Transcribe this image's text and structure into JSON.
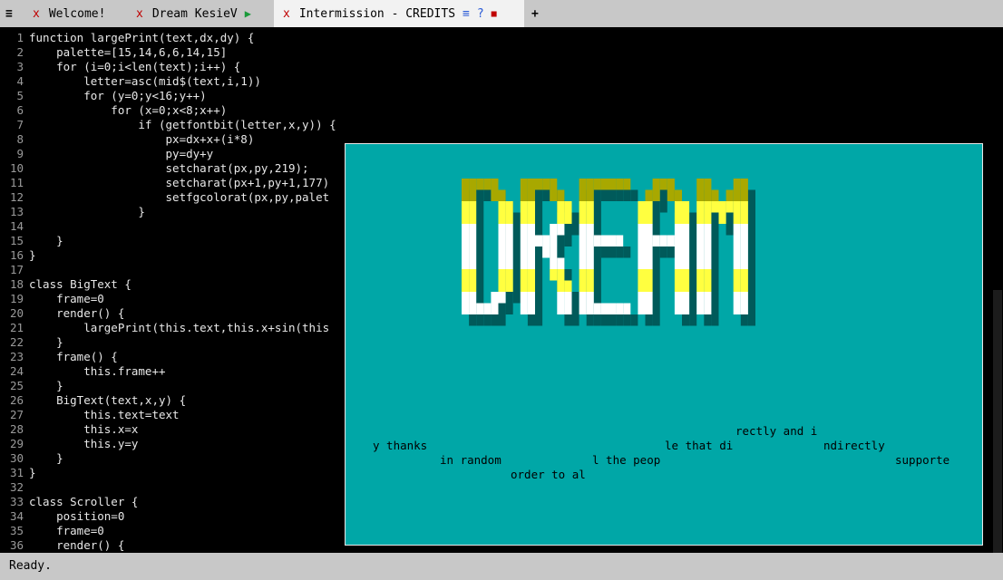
{
  "tabs": [
    {
      "menu": "≡"
    },
    {
      "close": "x",
      "label": "Welcome!"
    },
    {
      "close": "x",
      "label": "Dream KesieV",
      "run": "▶"
    },
    {
      "close": "x",
      "label": "Intermission - CREDITS",
      "extra_menu": "≡",
      "help": "?",
      "stop": "■"
    },
    {
      "add": "+"
    }
  ],
  "code_lines": [
    {
      "n": "1",
      "t": "function largePrint(text,dx,dy) {"
    },
    {
      "n": "2",
      "t": "    palette=[15,14,6,6,14,15]"
    },
    {
      "n": "3",
      "t": "    for (i=0;i<len(text);i++) {"
    },
    {
      "n": "4",
      "t": "        letter=asc(mid$(text,i,1))"
    },
    {
      "n": "5",
      "t": "        for (y=0;y<16;y++)"
    },
    {
      "n": "6",
      "t": "            for (x=0;x<8;x++)"
    },
    {
      "n": "7",
      "t": "                if (getfontbit(letter,x,y)) {"
    },
    {
      "n": "8",
      "t": "                    px=dx+x+(i*8)"
    },
    {
      "n": "9",
      "t": "                    py=dy+y"
    },
    {
      "n": "10",
      "t": "                    setcharat(px,py,219);"
    },
    {
      "n": "11",
      "t": "                    setcharat(px+1,py+1,177)"
    },
    {
      "n": "12",
      "t": "                    setfgcolorat(px,py,palet"
    },
    {
      "n": "13",
      "t": "                }"
    },
    {
      "n": "14",
      "t": ""
    },
    {
      "n": "15",
      "t": "    }"
    },
    {
      "n": "16",
      "t": "}"
    },
    {
      "n": "17",
      "t": ""
    },
    {
      "n": "18",
      "t": "class BigText {"
    },
    {
      "n": "19",
      "t": "    frame=0"
    },
    {
      "n": "20",
      "t": "    render() {"
    },
    {
      "n": "21",
      "t": "        largePrint(this.text,this.x+sin(this"
    },
    {
      "n": "22",
      "t": "    }"
    },
    {
      "n": "23",
      "t": "    frame() {"
    },
    {
      "n": "24",
      "t": "        this.frame++"
    },
    {
      "n": "25",
      "t": "    }"
    },
    {
      "n": "26",
      "t": "    BigText(text,x,y) {"
    },
    {
      "n": "27",
      "t": "        this.text=text"
    },
    {
      "n": "28",
      "t": "        this.x=x"
    },
    {
      "n": "29",
      "t": "        this.y=y"
    },
    {
      "n": "30",
      "t": "    }"
    },
    {
      "n": "31",
      "t": "}"
    },
    {
      "n": "32",
      "t": ""
    },
    {
      "n": "33",
      "t": "class Scroller {"
    },
    {
      "n": "34",
      "t": "    position=0"
    },
    {
      "n": "35",
      "t": "    frame=0"
    },
    {
      "n": "36",
      "t": "    render() {"
    }
  ],
  "preview": {
    "logo_text": "DREAM",
    "credit_fragments": [
      "rectly and i",
      "y thanks",
      "le that di",
      "ndirectly",
      "in random",
      "l the peop",
      "supporte",
      "order to al"
    ],
    "colors": {
      "bg": "#00a7a7",
      "white": "#ffffff",
      "yellow": "#ffff40",
      "olive": "#a8a800",
      "shadow": "#005a5a"
    }
  },
  "status": "Ready."
}
